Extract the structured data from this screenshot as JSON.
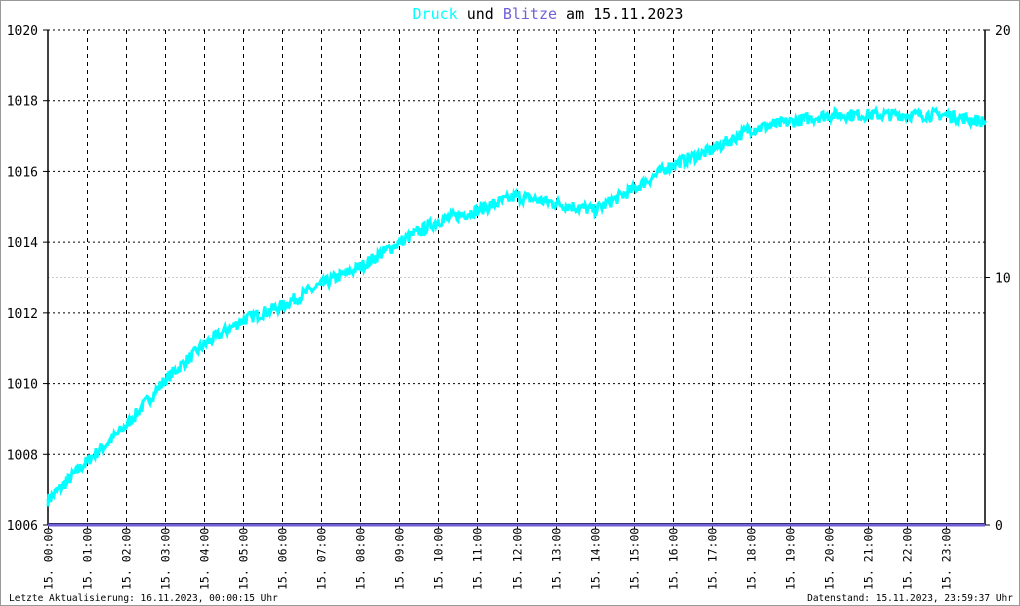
{
  "chart_data": {
    "type": "line",
    "title_parts": [
      {
        "text": "Druck",
        "color": "#00ffff"
      },
      {
        "text": " und ",
        "color": "#000000"
      },
      {
        "text": "Blitze",
        "color": "#7060d8"
      },
      {
        "text": " am 15.11.2023",
        "color": "#000000"
      }
    ],
    "x_hours": [
      0,
      1,
      2,
      3,
      4,
      5,
      6,
      7,
      8,
      9,
      10,
      11,
      12,
      13,
      14,
      15,
      16,
      17,
      18,
      19,
      20,
      21,
      22,
      23,
      24
    ],
    "x_tick_labels": [
      "15. 00:00",
      "15. 01:00",
      "15. 02:00",
      "15. 03:00",
      "15. 04:00",
      "15. 05:00",
      "15. 06:00",
      "15. 07:00",
      "15. 08:00",
      "15. 09:00",
      "15. 10:00",
      "15. 11:00",
      "15. 12:00",
      "15. 13:00",
      "15. 14:00",
      "15. 15:00",
      "15. 16:00",
      "15. 17:00",
      "15. 18:00",
      "15. 19:00",
      "15. 20:00",
      "15. 21:00",
      "15. 22:00",
      "15. 23:00"
    ],
    "y_left": {
      "range": [
        1006,
        1020
      ],
      "ticks": [
        "1006",
        "1008",
        "1010",
        "1012",
        "1014",
        "1016",
        "1018",
        "1020"
      ]
    },
    "y_right": {
      "range": [
        0,
        20
      ],
      "ticks": [
        "0",
        "10",
        "20"
      ]
    },
    "series": [
      {
        "name": "Druck",
        "color": "#00ffff",
        "axis": "left",
        "values": [
          1006.7,
          1007.8,
          1008.8,
          1010.1,
          1011.1,
          1011.8,
          1012.2,
          1012.8,
          1013.3,
          1014.0,
          1014.6,
          1014.9,
          1015.3,
          1015.1,
          1014.9,
          1015.5,
          1016.2,
          1016.6,
          1017.2,
          1017.4,
          1017.6,
          1017.6,
          1017.6,
          1017.6,
          1017.4
        ]
      },
      {
        "name": "Blitze",
        "color": "#7060d8",
        "axis": "right",
        "values": [
          0,
          0,
          0,
          0,
          0,
          0,
          0,
          0,
          0,
          0,
          0,
          0,
          0,
          0,
          0,
          0,
          0,
          0,
          0,
          0,
          0,
          0,
          0,
          0,
          0
        ]
      }
    ],
    "grid": true
  },
  "footer": {
    "left": "Letzte Aktualisierung: 16.11.2023, 00:00:15 Uhr",
    "right": "Datenstand: 15.11.2023, 23:59:37 Uhr"
  }
}
